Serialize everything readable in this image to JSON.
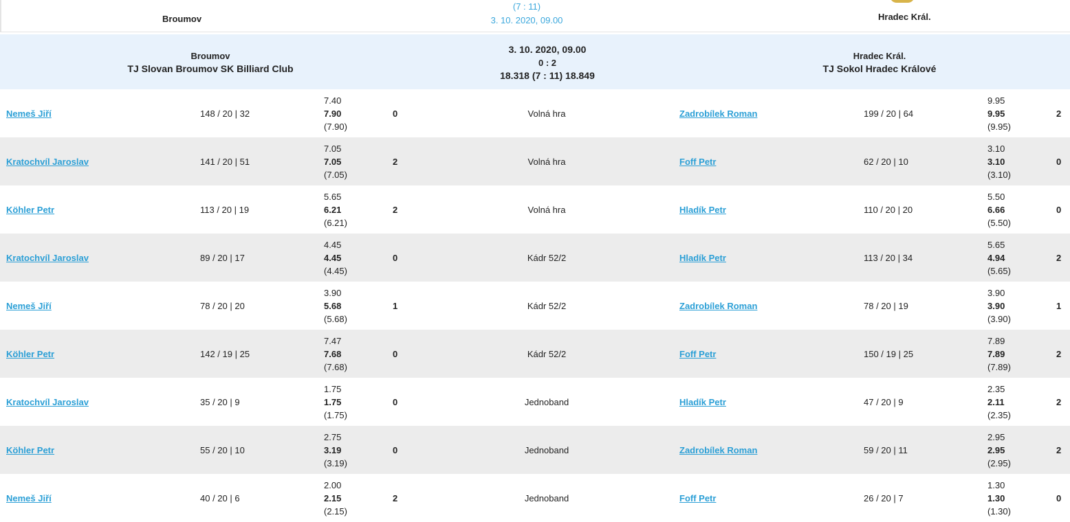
{
  "top": {
    "home_name": "Broumov",
    "away_name": "Hradec Král.",
    "sets": "(7 : 11)",
    "date": "3. 10. 2020, 09.00"
  },
  "header": {
    "home_city": "Broumov",
    "home_club": "TJ Slovan Broumov SK Billiard Club",
    "date": "3. 10. 2020, 09.00",
    "score": "0 : 2",
    "averages": "18.318  (7 : 11)  18.849",
    "away_city": "Hradec Král.",
    "away_club": "TJ Sokol Hradec Králové"
  },
  "matches": [
    {
      "home_player": "Nemeš Jiří",
      "home_stats": "148 / 20 | 32",
      "home_avg1": "7.40",
      "home_avg2": "7.90",
      "home_avg3": "(7.90)",
      "home_points": "0",
      "discipline": "Volná hra",
      "away_player": "Zadrobílek Roman",
      "away_stats": "199 / 20 | 64",
      "away_avg1": "9.95",
      "away_avg2": "9.95",
      "away_avg3": "(9.95)",
      "away_points": "2"
    },
    {
      "home_player": "Kratochvíl Jaroslav",
      "home_stats": "141 / 20 | 51",
      "home_avg1": "7.05",
      "home_avg2": "7.05",
      "home_avg3": "(7.05)",
      "home_points": "2",
      "discipline": "Volná hra",
      "away_player": "Foff Petr",
      "away_stats": "62 / 20 | 10",
      "away_avg1": "3.10",
      "away_avg2": "3.10",
      "away_avg3": "(3.10)",
      "away_points": "0"
    },
    {
      "home_player": "Köhler Petr",
      "home_stats": "113 / 20 | 19",
      "home_avg1": "5.65",
      "home_avg2": "6.21",
      "home_avg3": "(6.21)",
      "home_points": "2",
      "discipline": "Volná hra",
      "away_player": "Hladík Petr",
      "away_stats": "110 / 20 | 20",
      "away_avg1": "5.50",
      "away_avg2": "6.66",
      "away_avg3": "(5.50)",
      "away_points": "0"
    },
    {
      "home_player": "Kratochvíl Jaroslav",
      "home_stats": "89 / 20 | 17",
      "home_avg1": "4.45",
      "home_avg2": "4.45",
      "home_avg3": "(4.45)",
      "home_points": "0",
      "discipline": "Kádr 52/2",
      "away_player": "Hladík Petr",
      "away_stats": "113 / 20 | 34",
      "away_avg1": "5.65",
      "away_avg2": "4.94",
      "away_avg3": "(5.65)",
      "away_points": "2"
    },
    {
      "home_player": "Nemeš Jiří",
      "home_stats": "78 / 20 | 20",
      "home_avg1": "3.90",
      "home_avg2": "5.68",
      "home_avg3": "(5.68)",
      "home_points": "1",
      "discipline": "Kádr 52/2",
      "away_player": "Zadrobílek Roman",
      "away_stats": "78 / 20 | 19",
      "away_avg1": "3.90",
      "away_avg2": "3.90",
      "away_avg3": "(3.90)",
      "away_points": "1"
    },
    {
      "home_player": "Köhler Petr",
      "home_stats": "142 / 19 | 25",
      "home_avg1": "7.47",
      "home_avg2": "7.68",
      "home_avg3": "(7.68)",
      "home_points": "0",
      "discipline": "Kádr 52/2",
      "away_player": "Foff Petr",
      "away_stats": "150 / 19 | 25",
      "away_avg1": "7.89",
      "away_avg2": "7.89",
      "away_avg3": "(7.89)",
      "away_points": "2"
    },
    {
      "home_player": "Kratochvíl Jaroslav",
      "home_stats": "35 / 20 | 9",
      "home_avg1": "1.75",
      "home_avg2": "1.75",
      "home_avg3": "(1.75)",
      "home_points": "0",
      "discipline": "Jednoband",
      "away_player": "Hladík Petr",
      "away_stats": "47 / 20 | 9",
      "away_avg1": "2.35",
      "away_avg2": "2.11",
      "away_avg3": "(2.35)",
      "away_points": "2"
    },
    {
      "home_player": "Köhler Petr",
      "home_stats": "55 / 20 | 10",
      "home_avg1": "2.75",
      "home_avg2": "3.19",
      "home_avg3": "(3.19)",
      "home_points": "0",
      "discipline": "Jednoband",
      "away_player": "Zadrobílek Roman",
      "away_stats": "59 / 20 | 11",
      "away_avg1": "2.95",
      "away_avg2": "2.95",
      "away_avg3": "(2.95)",
      "away_points": "2"
    },
    {
      "home_player": "Nemeš Jiří",
      "home_stats": "40 / 20 | 6",
      "home_avg1": "2.00",
      "home_avg2": "2.15",
      "home_avg3": "(2.15)",
      "home_points": "2",
      "discipline": "Jednoband",
      "away_player": "Foff Petr",
      "away_stats": "26 / 20 | 7",
      "away_avg1": "1.30",
      "away_avg2": "1.30",
      "away_avg3": "(1.30)",
      "away_points": "0"
    }
  ]
}
